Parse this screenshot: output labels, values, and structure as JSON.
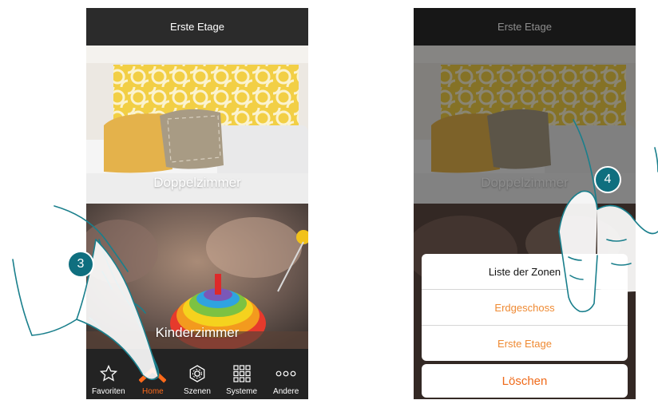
{
  "colors": {
    "accent": "#ff6a1a",
    "option_text": "#ef8a33",
    "step_badge": "#0f6f7f",
    "bar": "#2b2b2b"
  },
  "left_screen": {
    "title": "Erste Etage",
    "rooms": [
      {
        "label": "Doppelzimmer"
      },
      {
        "label": "Kinderzimmer"
      }
    ],
    "nav": [
      {
        "label": "Favoriten",
        "icon": "star-icon",
        "active": false
      },
      {
        "label": "Home",
        "icon": "home-icon",
        "active": true
      },
      {
        "label": "Szenen",
        "icon": "scenes-icon",
        "active": false
      },
      {
        "label": "Systeme",
        "icon": "grid-icon",
        "active": false
      },
      {
        "label": "Andere",
        "icon": "more-icon",
        "active": false
      }
    ],
    "step": "3"
  },
  "right_screen": {
    "title": "Erste Etage",
    "rooms": [
      {
        "label": "Doppelzimmer"
      }
    ],
    "sheet": {
      "title": "Liste der Zonen",
      "options": [
        "Erdgeschoss",
        "Erste Etage"
      ],
      "cancel": "Löschen"
    },
    "step": "4"
  }
}
